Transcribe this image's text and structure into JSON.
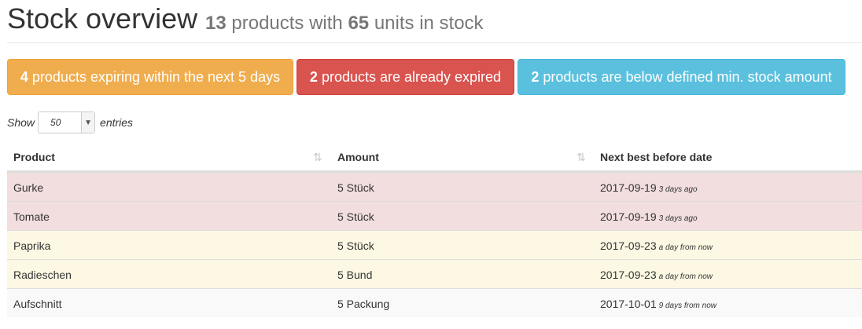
{
  "header": {
    "title": "Stock overview",
    "product_count": "13",
    "text_products_with": "products with",
    "unit_count": "65",
    "text_units_in_stock": "units in stock"
  },
  "alerts": [
    {
      "count": "4",
      "text": "products expiring within the next 5 days",
      "color": "#f0ad4e"
    },
    {
      "count": "2",
      "text": "products are already expired",
      "color": "#d9534f"
    },
    {
      "count": "2",
      "text": "products are below defined min. stock amount",
      "color": "#5bc0de"
    }
  ],
  "entries": {
    "show_label": "Show",
    "selected": "50",
    "entries_label": "entries"
  },
  "table": {
    "columns": [
      "Product",
      "Amount",
      "Next best before date"
    ],
    "sort_icon": "sort-icon",
    "rows": [
      {
        "product": "Gurke",
        "amount": "5 Stück",
        "date": "2017-09-19",
        "relative": "3 days ago",
        "status": "expired"
      },
      {
        "product": "Tomate",
        "amount": "5 Stück",
        "date": "2017-09-19",
        "relative": "3 days ago",
        "status": "expired"
      },
      {
        "product": "Paprika",
        "amount": "5 Stück",
        "date": "2017-09-23",
        "relative": "a day from now",
        "status": "expiring"
      },
      {
        "product": "Radieschen",
        "amount": "5 Bund",
        "date": "2017-09-23",
        "relative": "a day from now",
        "status": "expiring"
      },
      {
        "product": "Aufschnitt",
        "amount": "5 Packung",
        "date": "2017-10-01",
        "relative": "9 days from now",
        "status": "ok"
      }
    ]
  },
  "colors": {
    "expired_row": "#f2dede",
    "expiring_row": "#fcf8e3",
    "normal_row": "#f9f9f9"
  }
}
